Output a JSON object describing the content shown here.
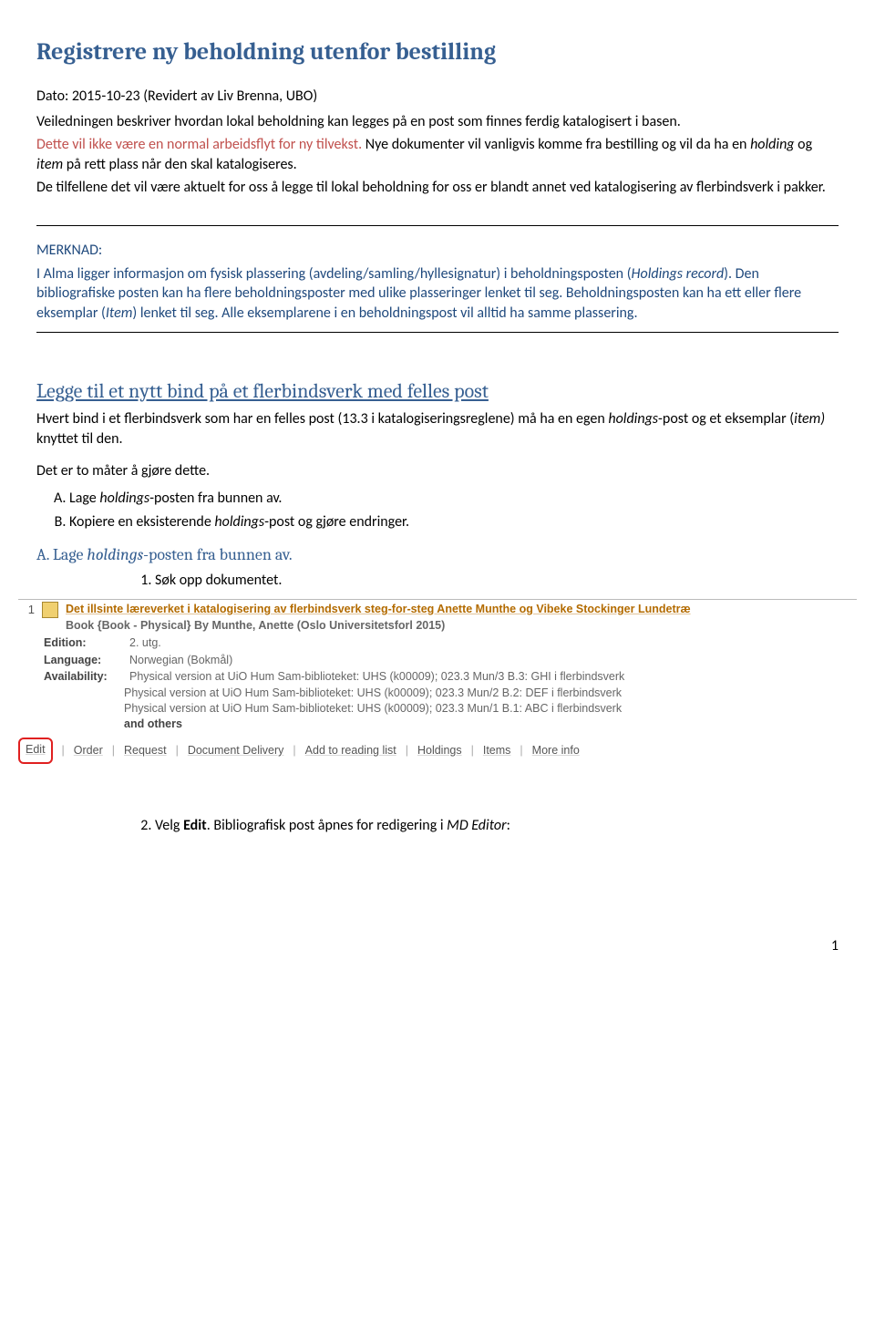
{
  "title": "Registrere ny beholdning utenfor bestilling",
  "date_line": "Dato: 2015-10-23 (Revidert av Liv Brenna, UBO)",
  "intro_p1": "Veiledningen beskriver hvordan lokal beholdning kan legges på en post som finnes ferdig katalogisert i basen.",
  "intro_red": "Dette vil ikke være en normal arbeidsflyt for ny tilvekst.",
  "intro_p2a": "Nye dokumenter vil vanligvis komme fra bestilling og vil da ha en ",
  "intro_p2_holding": "holding",
  "intro_p2b": " og ",
  "intro_p2_item": "item",
  "intro_p2c": " på rett plass når den skal katalogiseres.",
  "intro_p3": "De tilfellene det vil være aktuelt for oss å legge til lokal beholdning for oss er blandt annet ved katalogisering av flerbindsverk i pakker.",
  "merknad_label": "MERKNAD:",
  "merknad_p_a": "I Alma ligger informasjon om fysisk plassering (avdeling/samling/hyllesignatur) i beholdningsposten (",
  "merknad_holdings_record": "Holdings record",
  "merknad_p_b": "). Den bibliografiske posten kan ha flere beholdningsposter med ulike plasseringer lenket til seg. Beholdningsposten kan ha ett eller flere eksemplar (",
  "merknad_item": "Item",
  "merknad_p_c": ") lenket til seg. Alle eksemplarene i en beholdningspost vil alltid ha samme plassering.",
  "section2_title": "Legge til et nytt bind på et flerbindsverk med felles post",
  "section2_p1_a": "Hvert bind i et flerbindsverk som har en felles post (13.3 i katalogiseringsreglene) må ha en egen ",
  "section2_p1_holdings": "holdings",
  "section2_p1_b": "-post og et eksemplar (",
  "section2_p1_item": "item)",
  "section2_p1_c": " knyttet til den.",
  "section2_p2": "Det er to måter å gjøre dette.",
  "list_a_pre": "Lage ",
  "list_a_holdings": "holdings",
  "list_a_post": "-posten fra bunnen av.",
  "list_b_pre": "Kopiere en eksisterende ",
  "list_b_holdings": "holdings",
  "list_b_post": "-post og gjøre endringer.",
  "step_a_title_pre": "A. Lage ",
  "step_a_title_holdings": "holdings",
  "step_a_title_post": "-posten fra bunnen av.",
  "step_a_1": "Søk opp dokumentet.",
  "step_a_2_pre": "Velg ",
  "step_a_2_edit": "Edit",
  "step_a_2_post": ". Bibliografisk post åpnes for redigering i ",
  "step_a_2_md": "MD Editor",
  "step_a_2_end": ":",
  "screenshot": {
    "index": "1",
    "title": "Det illsinte læreverket i katalogisering av flerbindsverk steg-for-steg Anette Munthe og Vibeke Stockinger Lundetræ",
    "type_by": "Book {Book - Physical} By Munthe, Anette (Oslo Universitetsforl 2015)",
    "edition_label": "Edition:",
    "edition_val": "2. utg.",
    "language_label": "Language:",
    "language_val": "Norwegian (Bokmål)",
    "avail_label": "Availability:",
    "avail_1": "Physical version at UiO Hum Sam-biblioteket: UHS (k00009); 023.3 Mun/3 B.3: GHI i flerbindsverk",
    "avail_2": "Physical version at UiO Hum Sam-biblioteket: UHS (k00009); 023.3 Mun/2 B.2: DEF i flerbindsverk",
    "avail_3": "Physical version at UiO Hum Sam-biblioteket: UHS (k00009); 023.3 Mun/1 B.1: ABC i flerbindsverk",
    "avail_more": "and others",
    "actions": {
      "edit": "Edit",
      "order": "Order",
      "request": "Request",
      "docdel": "Document Delivery",
      "addlist": "Add to reading list",
      "holdings": "Holdings",
      "items": "Items",
      "more": "More info"
    }
  },
  "page_number": "1"
}
